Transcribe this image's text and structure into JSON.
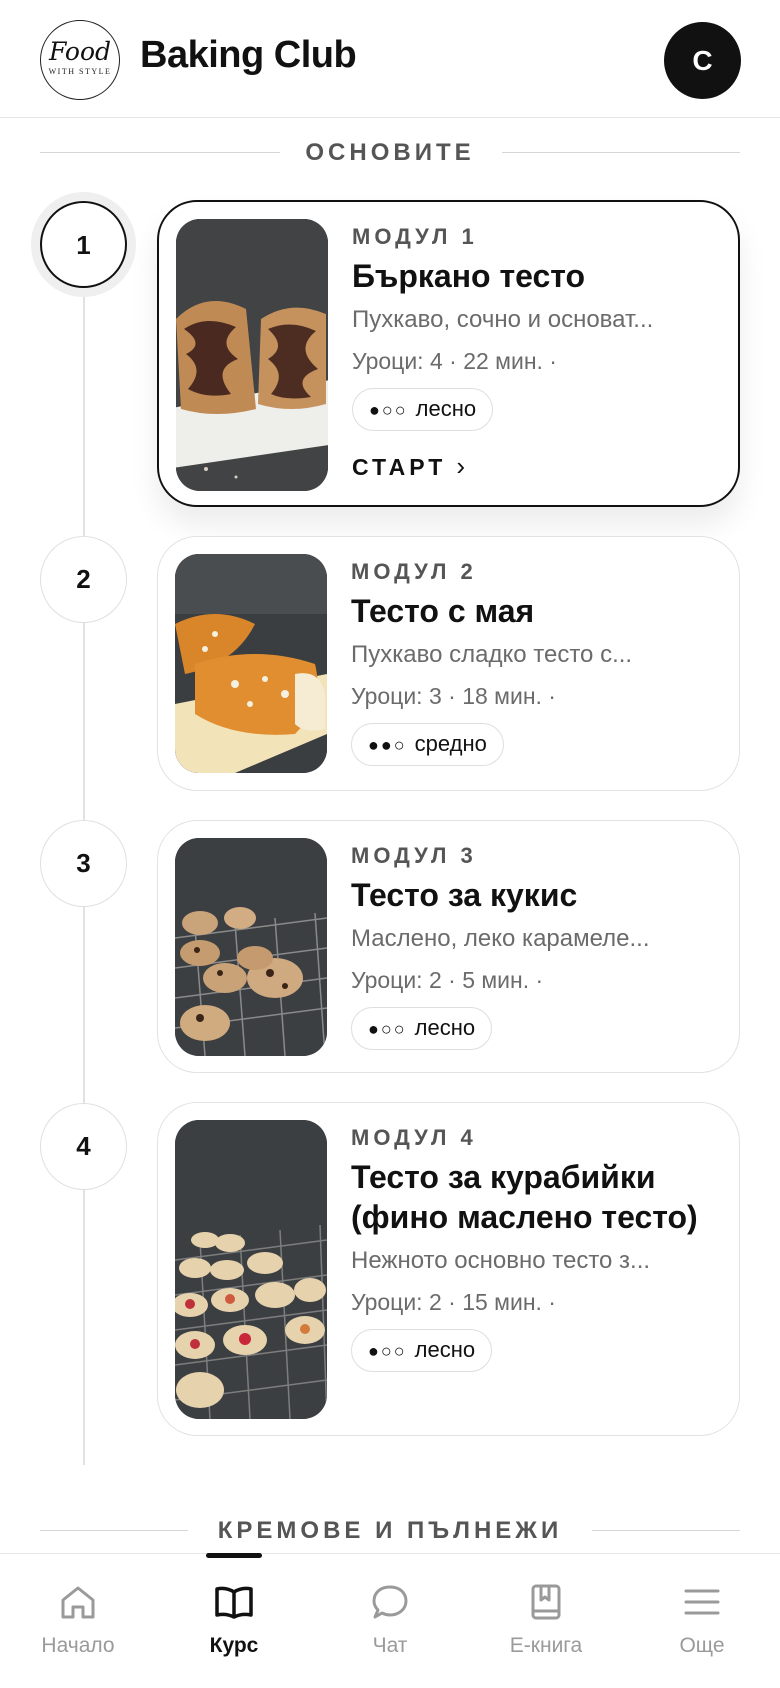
{
  "header": {
    "logo_script": "Food",
    "logo_sub": "WITH STYLE",
    "title": "Baking Club",
    "avatar_initial": "C"
  },
  "sections": [
    {
      "title": "ОСНОВИТЕ"
    },
    {
      "title": "КРЕМОВЕ И ПЪЛНЕЖИ"
    }
  ],
  "modules": [
    {
      "step": "1",
      "label": "МОДУЛ 1",
      "title": "Бъркано тесто",
      "description": "Пухкаво, сочно и основат...",
      "meta": "Уроци: 4 · 22 мин. ·",
      "difficulty_dots": "●○○",
      "difficulty": "лесно",
      "start_label": "СТАРТ",
      "active": true,
      "image": "marble-cake"
    },
    {
      "step": "2",
      "label": "МОДУЛ 2",
      "title": "Тесто с мая",
      "description": "Пухкаво сладко тесто с...",
      "meta": "Уроци: 3 · 18 мин. ·",
      "difficulty_dots": "●●○",
      "difficulty": "средно",
      "active": false,
      "image": "brioche-braid"
    },
    {
      "step": "3",
      "label": "МОДУЛ 3",
      "title": "Тесто за кукис",
      "description": "Маслено, леко карамеле...",
      "meta": "Уроци: 2 · 5 мин. ·",
      "difficulty_dots": "●○○",
      "difficulty": "лесно",
      "active": false,
      "image": "cookies-on-rack"
    },
    {
      "step": "4",
      "label": "МОДУЛ 4",
      "title": "Тесто за курабийки (фино маслено тесто)",
      "description": "Нежното основно тесто з...",
      "meta": "Уроци: 2 · 15 мин. ·",
      "difficulty_dots": "●○○",
      "difficulty": "лесно",
      "active": false,
      "image": "thumbprint-cookies"
    }
  ],
  "nav": [
    {
      "label": "Начало",
      "icon": "home-icon",
      "active": false
    },
    {
      "label": "Курс",
      "icon": "book-open-icon",
      "active": true
    },
    {
      "label": "Чат",
      "icon": "chat-bubble-icon",
      "active": false
    },
    {
      "label": "Е-книга",
      "icon": "ebook-icon",
      "active": false
    },
    {
      "label": "Още",
      "icon": "menu-icon",
      "active": false
    }
  ],
  "colors": {
    "accent": "#111111",
    "muted_text": "#6b6b6b",
    "border": "#e2e2e2",
    "background": "#ffffff"
  }
}
